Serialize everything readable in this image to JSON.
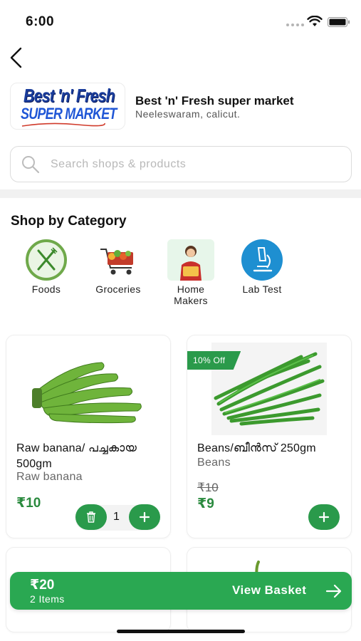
{
  "status_bar": {
    "time": "6:00"
  },
  "shop": {
    "logo_line1": "Best 'n' Fresh",
    "logo_line2": "SUPER MARKET",
    "name": "Best 'n' Fresh super market",
    "location": "Neeleswaram, calicut."
  },
  "search": {
    "placeholder": "Search shops & products"
  },
  "categories": {
    "title": "Shop by Category",
    "items": [
      {
        "label": "Foods",
        "icon": "fork-knife-icon"
      },
      {
        "label": "Groceries",
        "icon": "grocery-cart-icon"
      },
      {
        "label": "Home Makers",
        "icon": "home-maker-icon"
      },
      {
        "label": "Lab Test",
        "icon": "microscope-icon"
      }
    ]
  },
  "products": [
    {
      "title": "Raw banana/ പച്ചകായ 500gm",
      "subtitle": "Raw banana",
      "price": "₹10",
      "quantity": "1",
      "image": "raw-banana-image"
    },
    {
      "title": "Beans/ബീൻസ് 250gm",
      "subtitle": "Beans",
      "badge": "10% Off",
      "old_price": "₹10",
      "price": "₹9",
      "image": "green-beans-image"
    }
  ],
  "basket": {
    "total": "₹20",
    "items": "2 Items",
    "label": "View Basket"
  },
  "colors": {
    "accent": "#2aa852",
    "price_green": "#2a8a3e",
    "logo_blue": "#1a3d9c"
  }
}
